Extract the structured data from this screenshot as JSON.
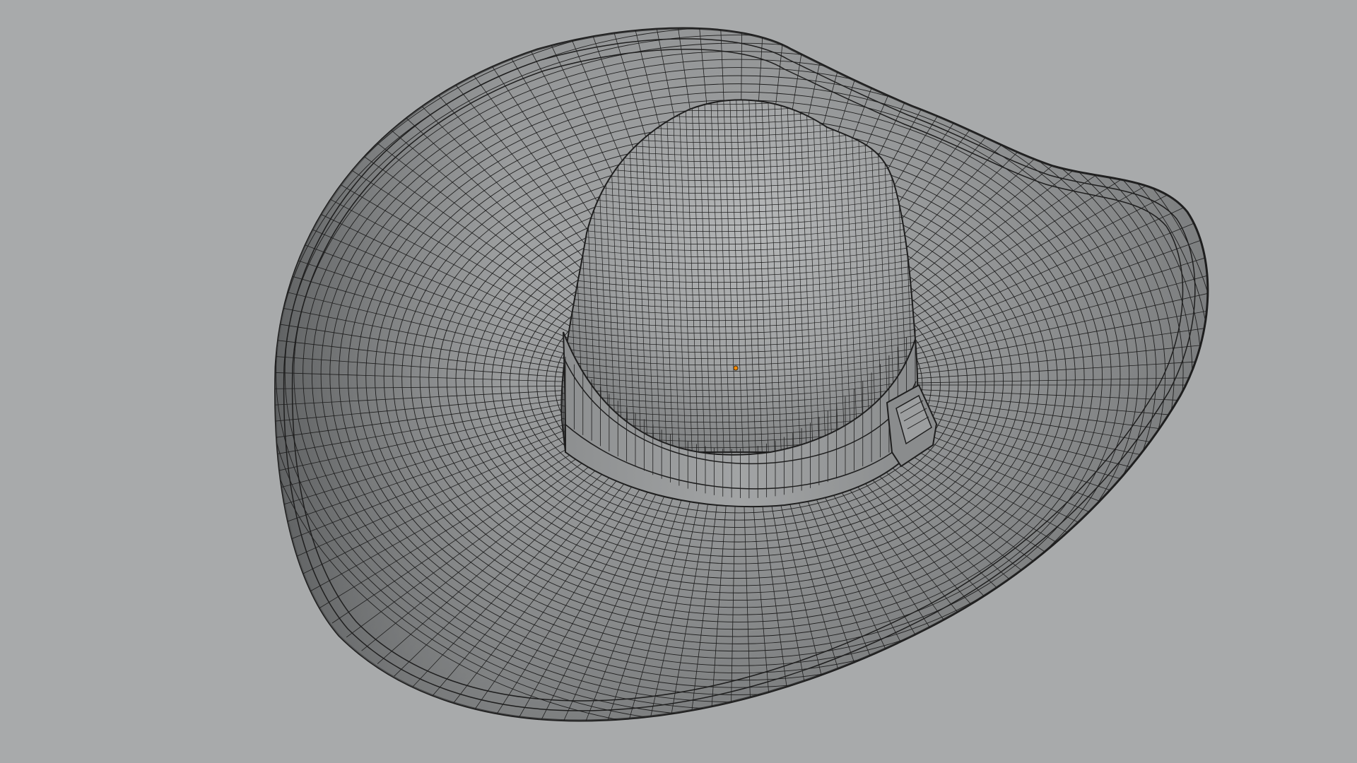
{
  "viewport": {
    "mode": "wireframe-on-shaded",
    "background_color": "#a8aaab",
    "surface_color": "#8f9192",
    "wire_color": "#1e1e1e",
    "origin_color": "#ff8a00"
  },
  "scene": {
    "object": "hat",
    "parts": [
      "brim",
      "crown",
      "band",
      "buckle"
    ]
  }
}
